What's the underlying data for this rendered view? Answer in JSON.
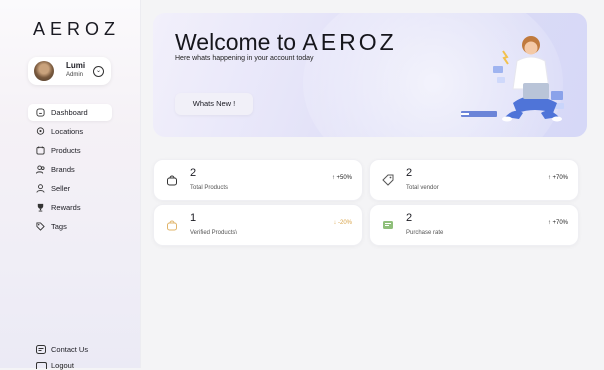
{
  "app": {
    "logo": "AEROZ"
  },
  "profile": {
    "name": "Lumi",
    "role": "Admin"
  },
  "sidebar": {
    "items": [
      {
        "label": "Dashboard",
        "icon": "home-icon",
        "active": true
      },
      {
        "label": "Locations",
        "icon": "location-pin-icon"
      },
      {
        "label": "Products",
        "icon": "calendar-box-icon"
      },
      {
        "label": "Brands",
        "icon": "users-icon"
      },
      {
        "label": "Seller",
        "icon": "user-icon"
      },
      {
        "label": "Rewards",
        "icon": "trophy-icon"
      },
      {
        "label": "Tags",
        "icon": "tag-icon"
      }
    ],
    "contact": "Contact Us",
    "logout": "Logout"
  },
  "banner": {
    "welcome_prefix": "Welcome to",
    "brand": "AEROZ",
    "subtitle": "Here whats happening in your account today",
    "button": "Whats New !"
  },
  "stats": [
    {
      "value": "2",
      "label": "Total Products",
      "trend": "+50%",
      "direction": "up",
      "icon": "shopping-bag-icon"
    },
    {
      "value": "2",
      "label": "Total vendor",
      "trend": "+70%",
      "direction": "up",
      "icon": "tag-icon"
    },
    {
      "value": "1",
      "label": "Verified Products\\",
      "trend": "-20%",
      "direction": "down",
      "icon": "bag-icon"
    },
    {
      "value": "2",
      "label": "Purchase rate",
      "trend": "+70%",
      "direction": "up",
      "icon": "receipt-icon"
    }
  ],
  "colors": {
    "accent": "#dcdcf6",
    "trend_down": "#d8a44a",
    "trend_up": "#222222"
  }
}
